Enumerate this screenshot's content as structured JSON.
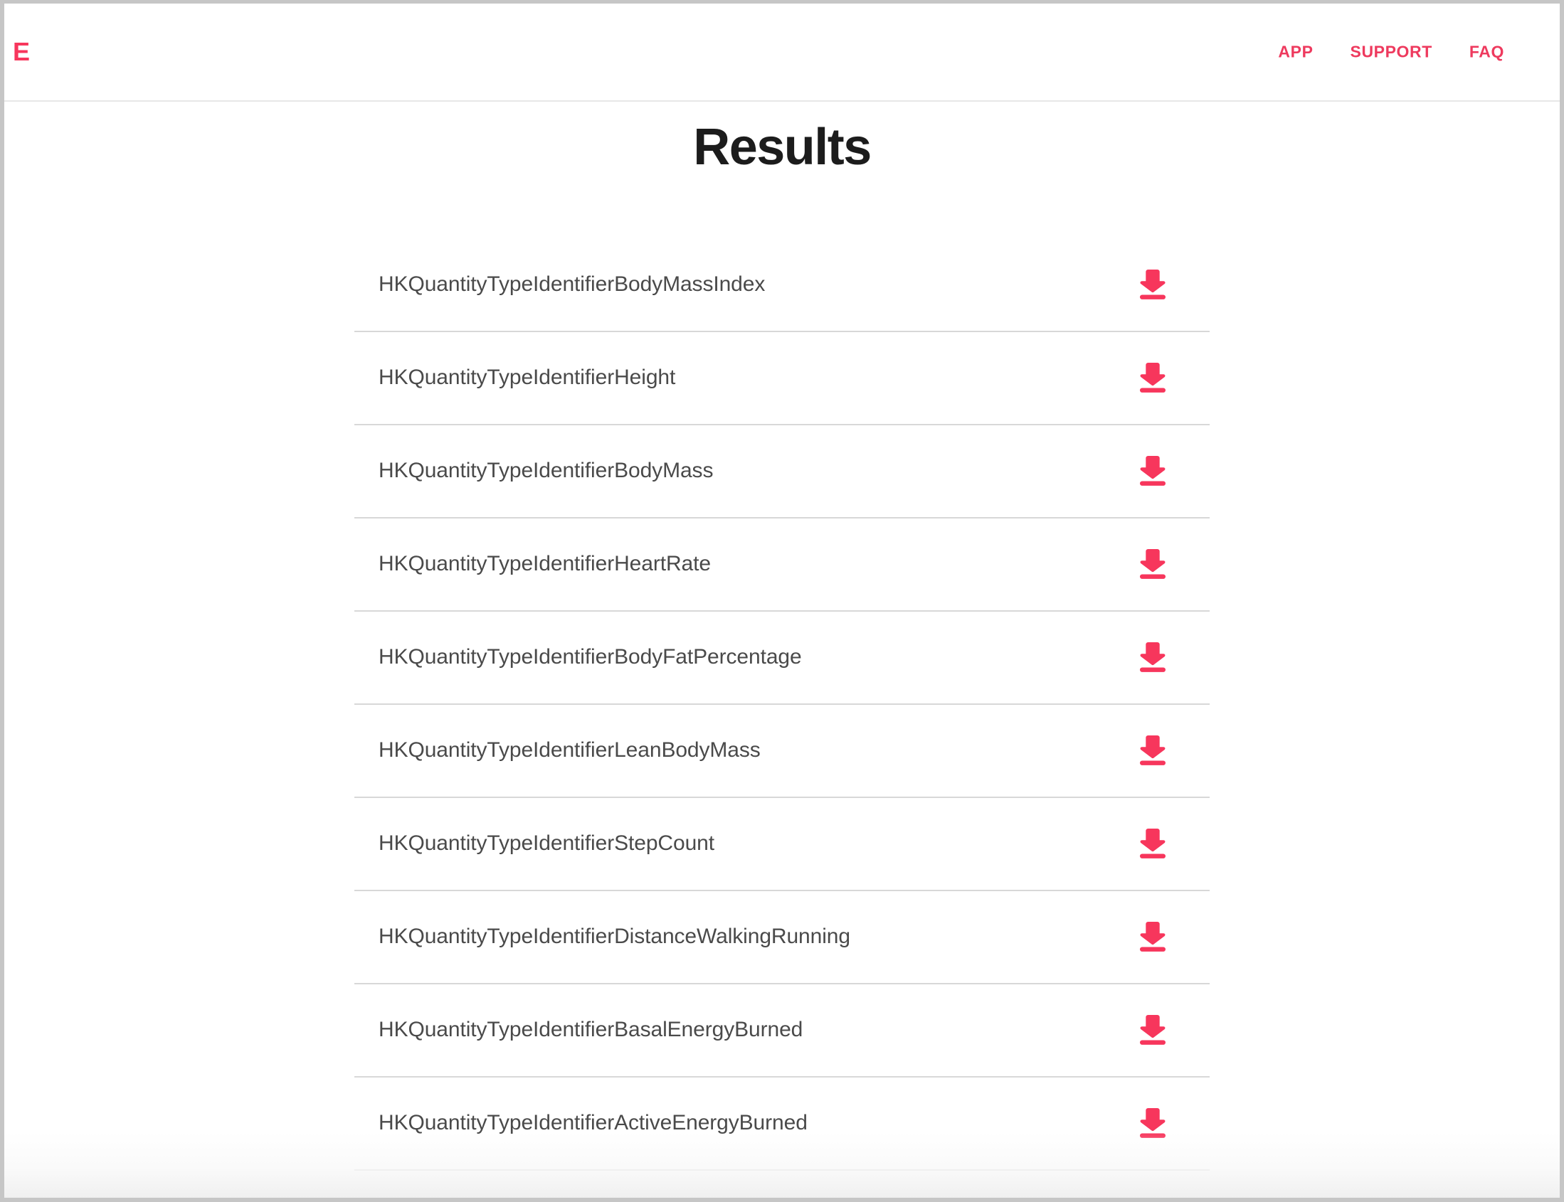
{
  "header": {
    "logo_text": "E",
    "logo_color": "#f7365c",
    "nav": [
      {
        "label": "APP"
      },
      {
        "label": "SUPPORT"
      },
      {
        "label": "FAQ"
      }
    ],
    "nav_color": "#ee3a5e"
  },
  "main": {
    "title": "Results",
    "title_color": "#1c1c1c",
    "download_icon_color": "#f7365c",
    "download_icon_name": "download-icon",
    "rows": [
      {
        "label": "HKQuantityTypeIdentifierBodyMassIndex"
      },
      {
        "label": "HKQuantityTypeIdentifierHeight"
      },
      {
        "label": "HKQuantityTypeIdentifierBodyMass"
      },
      {
        "label": "HKQuantityTypeIdentifierHeartRate"
      },
      {
        "label": "HKQuantityTypeIdentifierBodyFatPercentage"
      },
      {
        "label": "HKQuantityTypeIdentifierLeanBodyMass"
      },
      {
        "label": "HKQuantityTypeIdentifierStepCount"
      },
      {
        "label": "HKQuantityTypeIdentifierDistanceWalkingRunning"
      },
      {
        "label": "HKQuantityTypeIdentifierBasalEnergyBurned"
      },
      {
        "label": "HKQuantityTypeIdentifierActiveEnergyBurned"
      }
    ]
  }
}
